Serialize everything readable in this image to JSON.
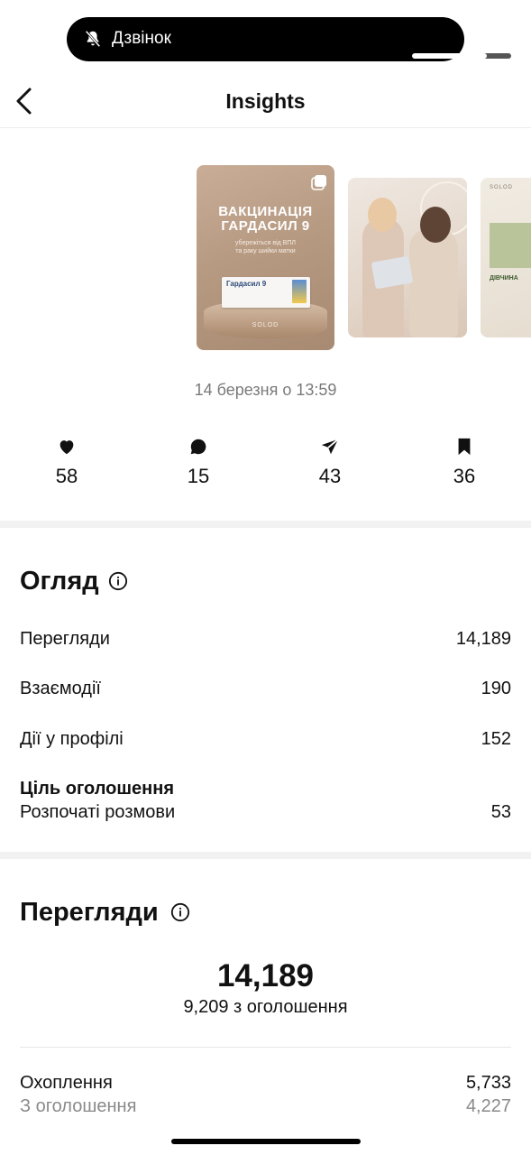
{
  "call": {
    "label": "Дзвінок",
    "progress": 0.75
  },
  "header": {
    "title": "Insights"
  },
  "carousel": {
    "slide1": {
      "title_line1": "ВАКЦИНАЦІЯ",
      "title_line2": "ГАРДАСИЛ 9",
      "subtitle_line1": "убережіться від ВПЛ",
      "subtitle_line2": "та раку шийки матки",
      "box_label": "Гардасил 9",
      "brand": "SOLOD"
    },
    "slide3": {
      "brand": "SOLOD",
      "label": "ДІВЧИНА"
    }
  },
  "post_date": "14 березня о 13:59",
  "stats": {
    "likes": "58",
    "comments": "15",
    "shares": "43",
    "saves": "36"
  },
  "overview": {
    "title": "Огляд",
    "rows": [
      {
        "label": "Перегляди",
        "value": "14,189"
      },
      {
        "label": "Взаємодії",
        "value": "190"
      },
      {
        "label": "Дії у профілі",
        "value": "152"
      }
    ],
    "ad_goal_title": "Ціль оголошення",
    "ad_goal": {
      "label": "Розпочаті розмови",
      "value": "53"
    }
  },
  "views": {
    "title": "Перегляди",
    "total": "14,189",
    "from_ads": "9,209 з оголошення",
    "reach": {
      "label": "Охоплення",
      "value": "5,733"
    },
    "reach_ads": {
      "label": "З оголошення",
      "value": "4,227"
    }
  },
  "colors": {
    "accent": "#111111",
    "muted": "#7a7a7a",
    "divider": "#f2f2f2"
  }
}
